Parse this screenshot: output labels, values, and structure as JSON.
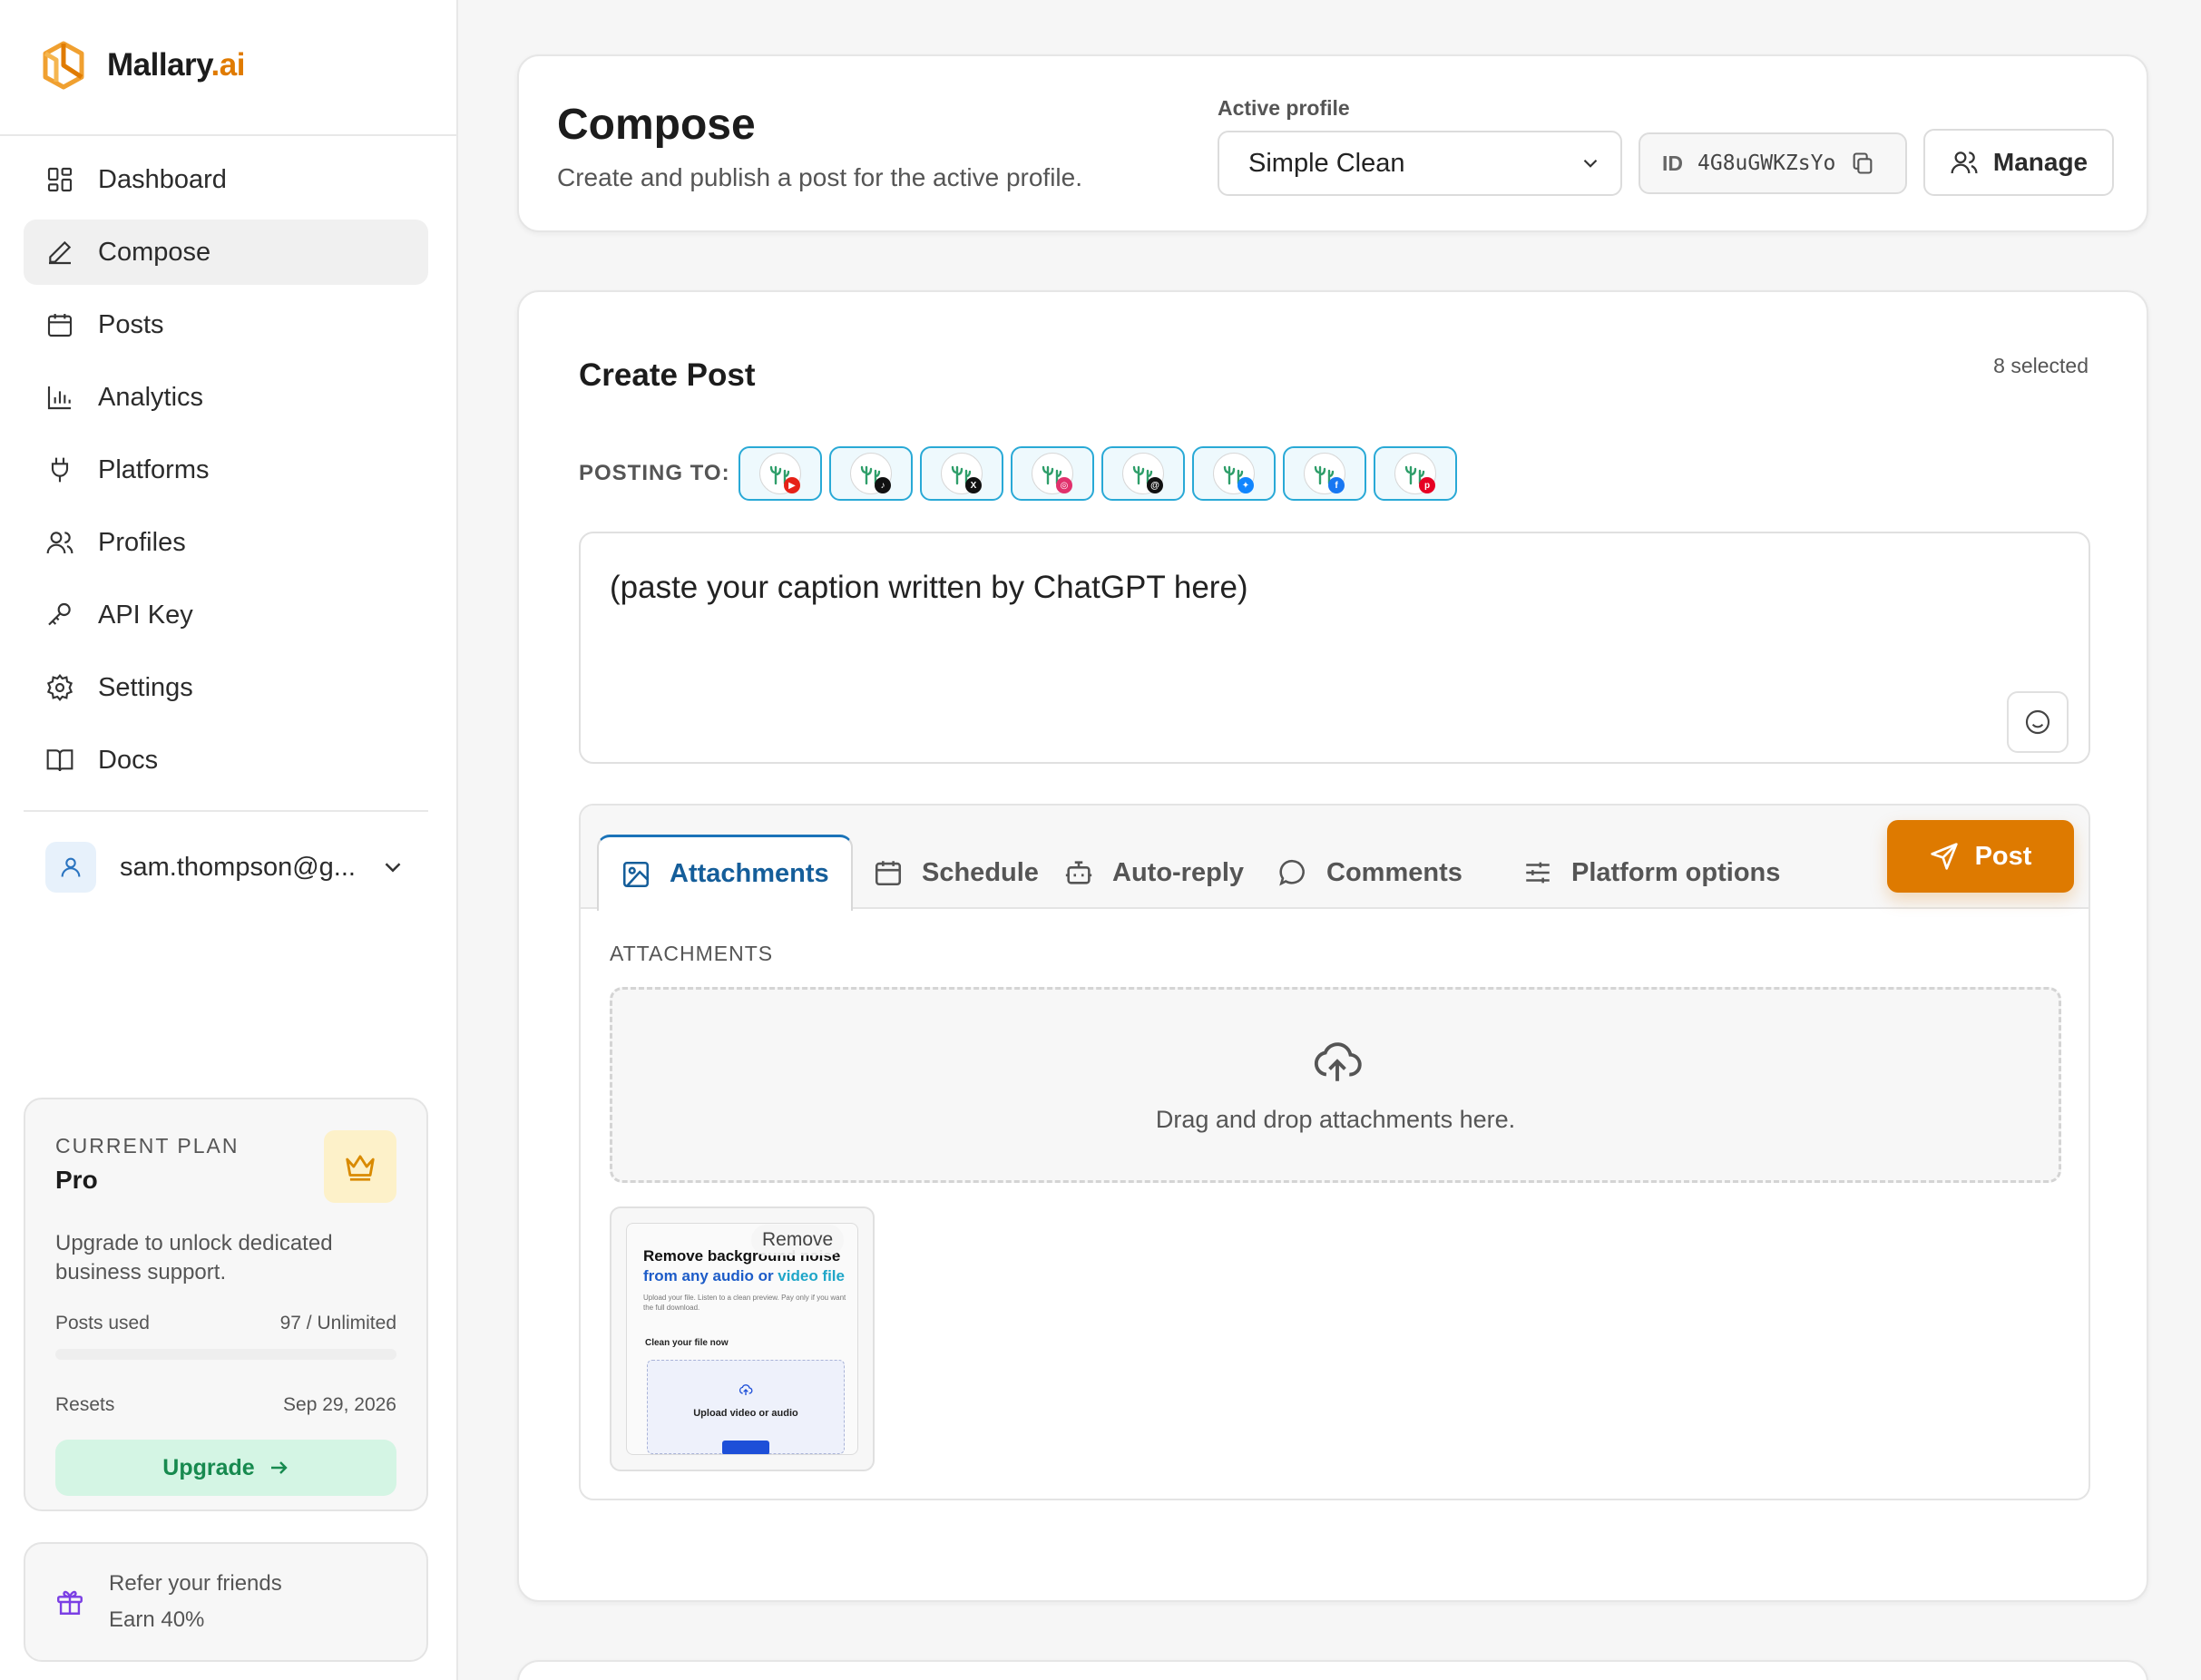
{
  "brand": {
    "name": "Mallary",
    "suffix": ".ai",
    "accent": "#e07b00"
  },
  "sidebar": {
    "items": [
      {
        "label": "Dashboard",
        "icon": "dashboard-icon",
        "active": false
      },
      {
        "label": "Compose",
        "icon": "pen-icon",
        "active": true
      },
      {
        "label": "Posts",
        "icon": "calendar-icon",
        "active": false
      },
      {
        "label": "Analytics",
        "icon": "bar-chart-icon",
        "active": false
      },
      {
        "label": "Platforms",
        "icon": "plug-icon",
        "active": false
      },
      {
        "label": "Profiles",
        "icon": "users-icon",
        "active": false
      },
      {
        "label": "API Key",
        "icon": "key-icon",
        "active": false
      },
      {
        "label": "Settings",
        "icon": "gear-icon",
        "active": false
      },
      {
        "label": "Docs",
        "icon": "book-icon",
        "active": false
      }
    ],
    "account": {
      "email": "sam.thompson@g..."
    },
    "plan": {
      "label": "CURRENT PLAN",
      "name": "Pro",
      "description": "Upgrade to unlock dedicated business support.",
      "posts_used_label": "Posts used",
      "posts_used_value": "97 / Unlimited",
      "usage_fraction": 0,
      "resets_label": "Resets",
      "resets_value": "Sep 29, 2026",
      "upgrade_label": "Upgrade"
    },
    "refer": {
      "line1": "Refer your friends",
      "line2": "Earn 40%"
    }
  },
  "header": {
    "title": "Compose",
    "subtitle": "Create and publish a post for the active profile.",
    "active_profile_label": "Active profile",
    "active_profile_value": "Simple Clean",
    "id_label": "ID",
    "id_value": "4G8uGWKZsYo",
    "manage_label": "Manage"
  },
  "create_post": {
    "title": "Create Post",
    "selected_count": "8 selected",
    "posting_to_label": "POSTING TO:",
    "platforms": [
      {
        "name": "youtube",
        "badge_color": "#e62117"
      },
      {
        "name": "tiktok",
        "badge_color": "#111111"
      },
      {
        "name": "x",
        "badge_color": "#111111"
      },
      {
        "name": "instagram",
        "badge_color": "#e1306c"
      },
      {
        "name": "threads",
        "badge_color": "#111111"
      },
      {
        "name": "bluesky",
        "badge_color": "#1185fe"
      },
      {
        "name": "facebook",
        "badge_color": "#1877f2"
      },
      {
        "name": "pinterest",
        "badge_color": "#e60023"
      }
    ],
    "caption": "(paste your caption written by ChatGPT here)",
    "tabs": [
      {
        "label": "Attachments",
        "icon": "image-icon",
        "active": true
      },
      {
        "label": "Schedule",
        "icon": "calendar-icon",
        "active": false
      },
      {
        "label": "Auto-reply",
        "icon": "bot-icon",
        "active": false
      },
      {
        "label": "Comments",
        "icon": "comment-icon",
        "active": false
      },
      {
        "label": "Platform options",
        "icon": "sliders-icon",
        "active": false
      }
    ],
    "post_button_label": "Post",
    "attachments_label": "ATTACHMENTS",
    "dropzone_text": "Drag and drop attachments here.",
    "attachment": {
      "remove_label": "Remove",
      "preview_heading_1": "Remove background noise",
      "preview_heading_2a": "from any audio or ",
      "preview_heading_2b": "video file",
      "preview_paragraph": "Upload your file. Listen to a clean preview. Pay only if you want the full download.",
      "preview_section": "Clean your file now",
      "preview_upload_text": "Upload video or audio"
    }
  }
}
